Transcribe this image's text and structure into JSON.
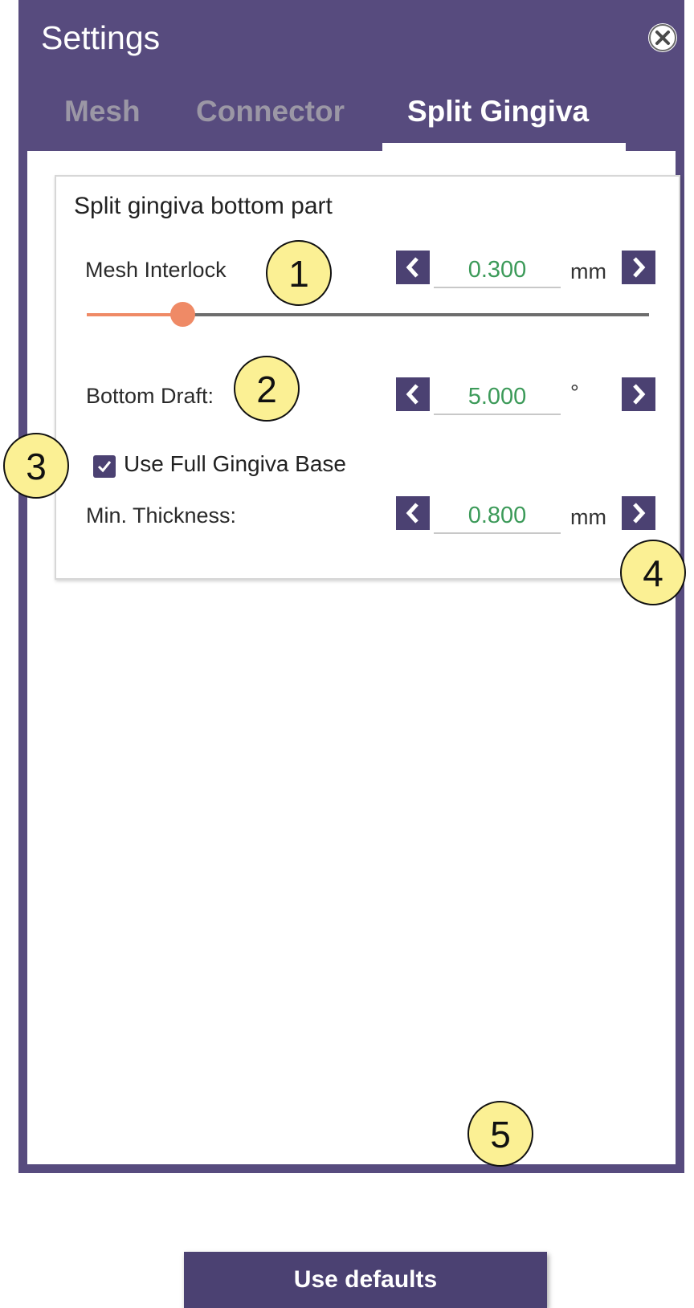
{
  "window": {
    "title": "Settings"
  },
  "tabs": [
    {
      "label": "Mesh",
      "active": false
    },
    {
      "label": "Connector",
      "active": false
    },
    {
      "label": "Split Gingiva",
      "active": true
    }
  ],
  "group": {
    "title": "Split gingiva bottom part",
    "mesh_interlock": {
      "label": "Mesh Interlock",
      "value": "0.300",
      "unit": "mm",
      "slider_fraction": 0.17
    },
    "bottom_draft": {
      "label": "Bottom Draft:",
      "value": "5.000",
      "unit": "°"
    },
    "full_base": {
      "label": "Use Full Gingiva Base",
      "checked": true
    },
    "min_thickness": {
      "label": "Min. Thickness:",
      "value": "0.800",
      "unit": "mm"
    }
  },
  "buttons": {
    "use_defaults": "Use defaults"
  },
  "callouts": [
    "1",
    "2",
    "3",
    "4",
    "5"
  ],
  "colors": {
    "panel": "#574b7e",
    "button": "#4b4172",
    "value_text": "#3c9a59",
    "slider_accent": "#ef8a66",
    "callout_fill": "#fbf094"
  },
  "icons": [
    "close-icon",
    "chevron-left-icon",
    "chevron-right-icon",
    "checkmark-icon"
  ]
}
